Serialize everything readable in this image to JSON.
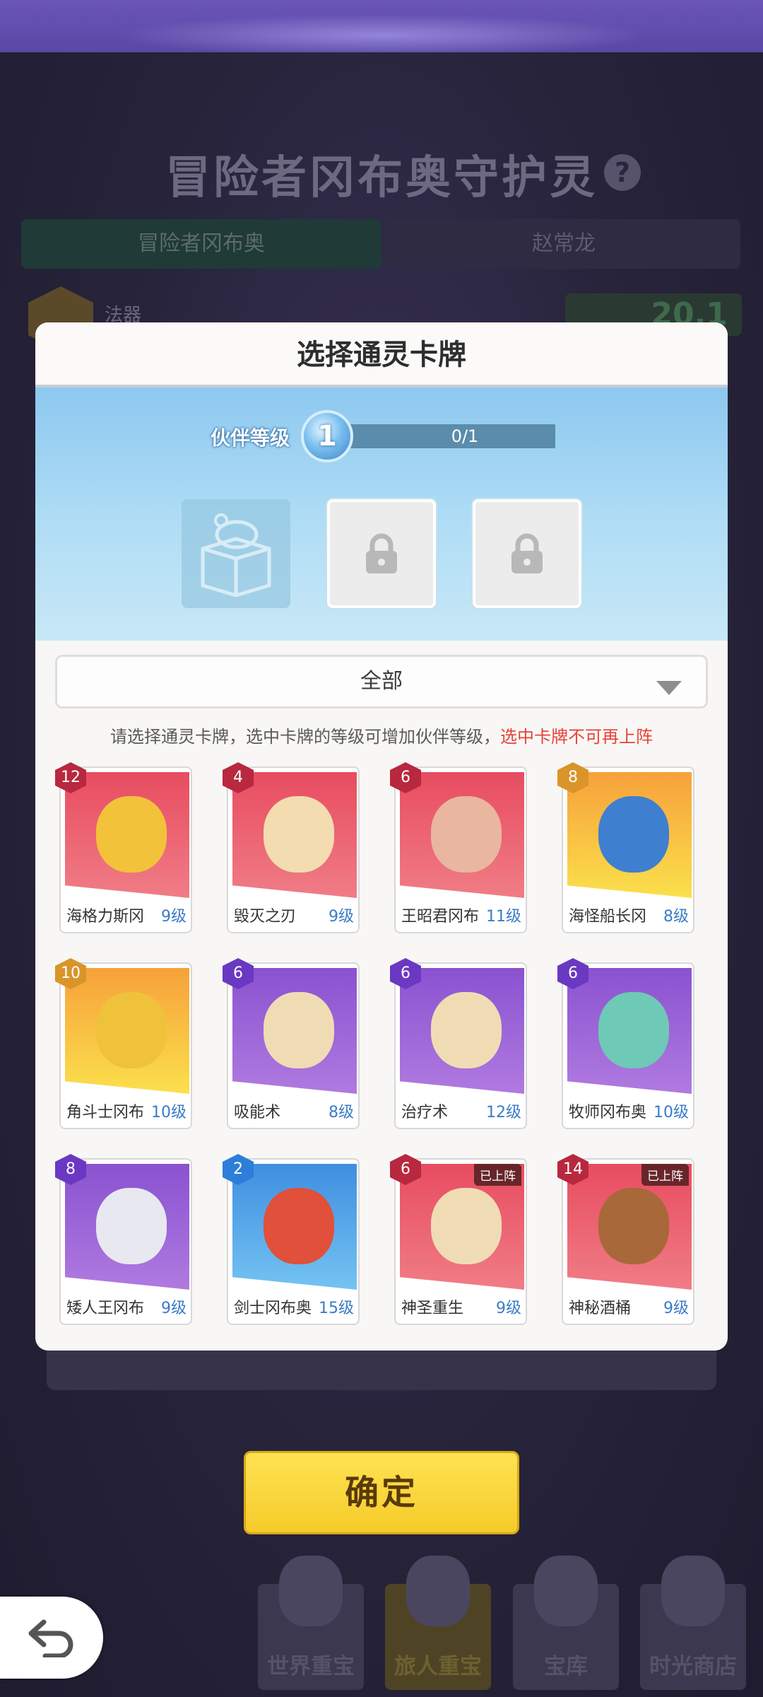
{
  "background": {
    "title": "冒险者冈布奥守护灵",
    "tabs": [
      "冒险者冈布奥",
      "赵常龙"
    ],
    "slot_label": "法器",
    "score": "20.1",
    "confirm_label": "确定",
    "shop": [
      "世界重宝",
      "旅人重宝",
      "宝库",
      "时光商店"
    ]
  },
  "modal": {
    "title": "选择通灵卡牌",
    "level_label": "伙伴等级",
    "level_value": "1",
    "progress_text": "0/1",
    "progress_fraction": 0,
    "filter_value": "全部",
    "hint_text": "请选择通灵卡牌，选中卡牌的等级可增加伙伴等级，",
    "hint_warning": "选中卡牌不可再上阵",
    "cards": [
      {
        "name": "海格力斯冈",
        "level": "9级",
        "rank": "12",
        "deployed": ""
      },
      {
        "name": "毁灭之刃",
        "level": "9级",
        "rank": "4",
        "deployed": ""
      },
      {
        "name": "王昭君冈布",
        "level": "11级",
        "rank": "6",
        "deployed": ""
      },
      {
        "name": "海怪船长冈",
        "level": "8级",
        "rank": "8",
        "deployed": ""
      },
      {
        "name": "角斗士冈布",
        "level": "10级",
        "rank": "10",
        "deployed": ""
      },
      {
        "name": "吸能术",
        "level": "8级",
        "rank": "6",
        "deployed": ""
      },
      {
        "name": "治疗术",
        "level": "12级",
        "rank": "6",
        "deployed": ""
      },
      {
        "name": "牧师冈布奥",
        "level": "10级",
        "rank": "6",
        "deployed": ""
      },
      {
        "name": "矮人王冈布",
        "level": "9级",
        "rank": "8",
        "deployed": ""
      },
      {
        "name": "剑士冈布奥",
        "level": "15级",
        "rank": "2",
        "deployed": ""
      },
      {
        "name": "神圣重生",
        "level": "9级",
        "rank": "6",
        "deployed": "已上阵"
      },
      {
        "name": "神秘酒桶",
        "level": "9级",
        "rank": "14",
        "deployed": "已上阵"
      }
    ]
  },
  "colors": {
    "accent_yellow": "#ffd93a",
    "warning_red": "#e6433a",
    "level_blue": "#3b7cc8"
  }
}
